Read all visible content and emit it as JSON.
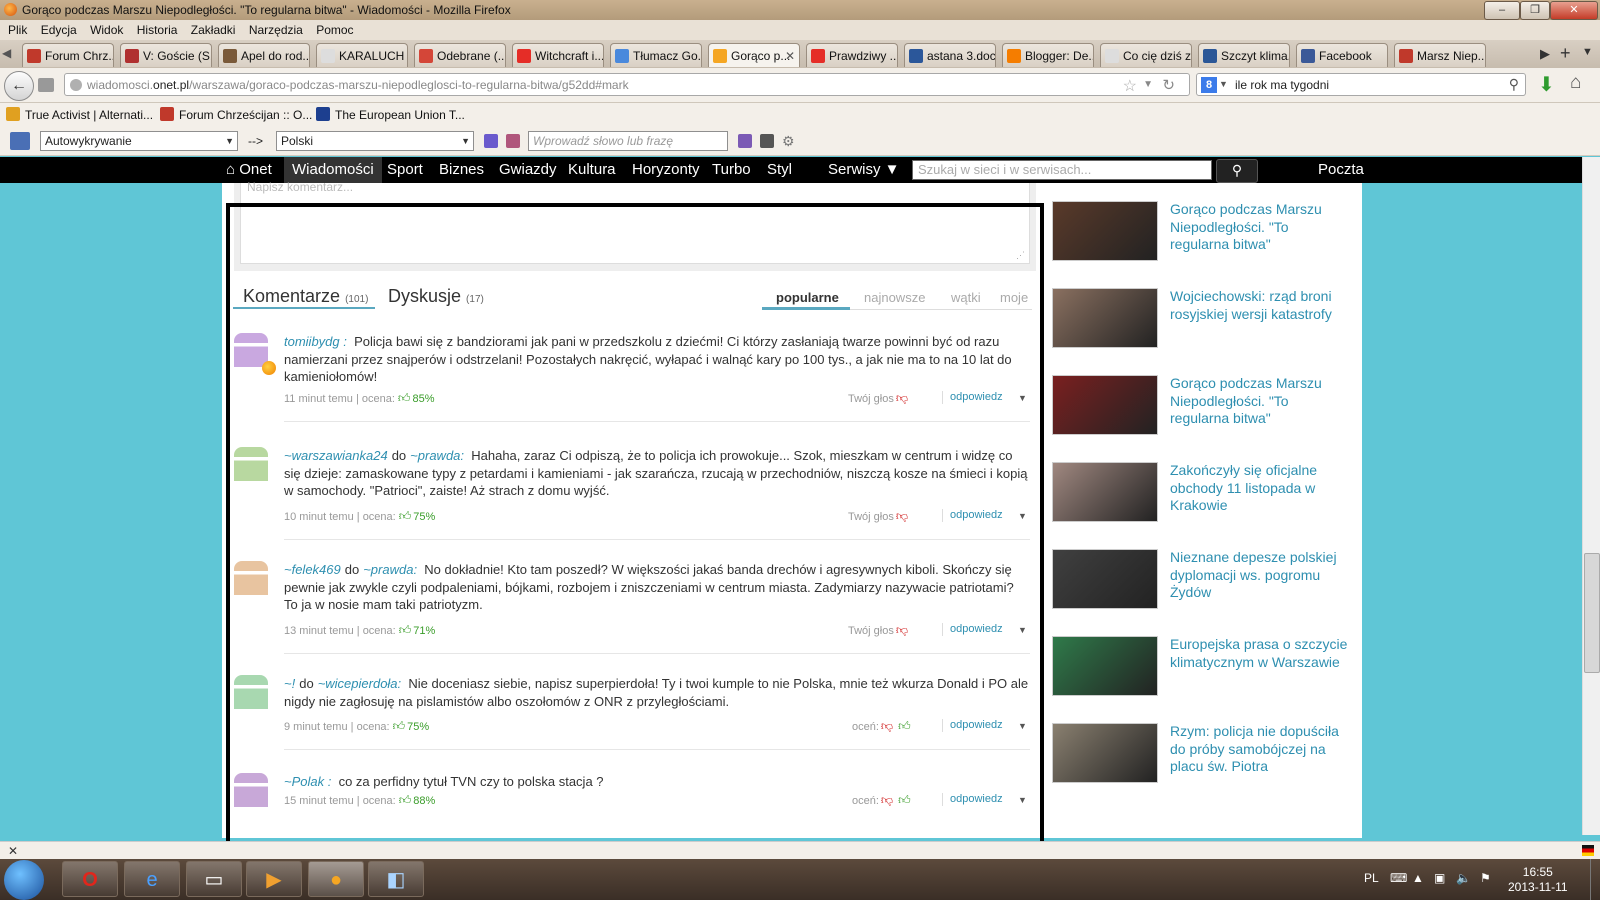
{
  "window": {
    "title": "Gorąco podczas Marszu Niepodległości. \"To regularna bitwa\" - Wiadomości - Mozilla Firefox",
    "buttons": [
      "–",
      "❐",
      "✕"
    ]
  },
  "menu": [
    "Plik",
    "Edycja",
    "Widok",
    "Historia",
    "Zakładki",
    "Narzędzia",
    "Pomoc"
  ],
  "tabs": [
    {
      "label": "Forum Chrz...",
      "icon_color": "#c0392b"
    },
    {
      "label": "V: Goście (S...",
      "icon_color": "#b03030"
    },
    {
      "label": "Apel do rod...",
      "icon_color": "#7a5a3a"
    },
    {
      "label": "KARALUCH",
      "icon_color": "#dddddd"
    },
    {
      "label": "Odebrane (...",
      "icon_color": "#d44638"
    },
    {
      "label": "Witchcraft i...",
      "icon_color": "#e52d27"
    },
    {
      "label": "Tłumacz Go...",
      "icon_color": "#4a89dc"
    },
    {
      "label": "Gorąco p...",
      "icon_color": "#f5a623",
      "active": true
    },
    {
      "label": "Prawdziwy ...",
      "icon_color": "#e52d27"
    },
    {
      "label": "astana 3.doc",
      "icon_color": "#2b579a"
    },
    {
      "label": "Blogger: De...",
      "icon_color": "#f57d00"
    },
    {
      "label": "Co cię dziś z...",
      "icon_color": "#dddddd"
    },
    {
      "label": "Szczyt klima...",
      "icon_color": "#2b5797"
    },
    {
      "label": "Facebook",
      "icon_color": "#3b5998"
    },
    {
      "label": "Marsz Niep...",
      "icon_color": "#c0392b"
    }
  ],
  "nav": {
    "url": "wiadomosci.onet.pl/warszawa/goraco-podczas-marszu-niepodleglosci-to-regularna-bitwa/g52dd#mark",
    "url_domain": "wiadomosci.",
    "url_bold": "onet.pl",
    "url_path": "/warszawa/goraco-podczas-marszu-niepodleglosci-to-regularna-bitwa/g52dd#mark",
    "search_value": "ile rok ma tygodni"
  },
  "bookmarks": [
    {
      "label": "True Activist | Alternati...",
      "icon_color": "#e0a020"
    },
    {
      "label": "Forum Chrześcijan :: O...",
      "icon_color": "#c0392b"
    },
    {
      "label": "The European Union T...",
      "icon_color": "#1d3f8f"
    }
  ],
  "translator": {
    "source_lang": "Autowykrywanie",
    "arrow": "-->",
    "target_lang": "Polski",
    "input_placeholder": "Wprowadź słowo lub frazę"
  },
  "site_nav": {
    "items": [
      "Onet",
      "Wiadomości",
      "Sport",
      "Biznes",
      "Gwiazdy",
      "Kultura",
      "Horyzonty",
      "Turbo",
      "Styl"
    ],
    "services": "Serwisy",
    "search_placeholder": "Szukaj w sieci i w serwisach...",
    "mail": "Poczta"
  },
  "comment_box": {
    "placeholder": "Napisz komentarz..."
  },
  "comments_header": {
    "tab_comments": "Komentarze",
    "comments_count": "(101)",
    "tab_discussions": "Dyskusje",
    "discussions_count": "(17)",
    "sort_options": [
      "popularne",
      "najnowsze",
      "wątki",
      "moje"
    ],
    "sort_active": "popularne"
  },
  "comments": [
    {
      "author": "tomiibydg :",
      "to": "",
      "text": "Policja bawi się z bandziorami jak pani w przedszkolu z dziećmi! Ci którzy zasłaniają twarze powinni być od razu namierzani przez snajperów i odstrzelani! Pozostałych nakręcić, wyłapać i walnąć kary po 100 tys., a jak nie ma to na 10 lat do kamieniołomów!",
      "time": "11 minut temu",
      "rating_label": "ocena:",
      "rating": "85%",
      "vote_label": "Twój głos",
      "reply": "odpowiedz",
      "avatar_color": "#c9a8e0"
    },
    {
      "author": "~warszawianka24",
      "to": "~prawda:",
      "text": "Hahaha, zaraz Ci odpiszą, że to policja ich prowokuje... Szok, mieszkam w centrum i widzę co się dzieje: zamaskowane typy z petardami i kamieniami - jak szarańcza, rzucają w przechodniów, niszczą kosze na śmieci i kopią w samochody. \"Patrioci\", zaiste! Aż strach z domu wyjść.",
      "time": "10 minut temu",
      "rating_label": "ocena:",
      "rating": "75%",
      "vote_label": "Twój głos",
      "reply": "odpowiedz",
      "avatar_color": "#b8d8a0"
    },
    {
      "author": "~felek469",
      "to": "~prawda:",
      "text": "No dokładnie! Kto tam poszedł? W większości jakaś banda drechów i agresywnych kiboli. Skończy się pewnie jak zwykle czyli podpaleniami, bójkami, rozbojem i zniszczeniami w centrum miasta. Zadymiarzy nazywacie patriotami? To ja w nosie mam taki patriotyzm.",
      "time": "13 minut temu",
      "rating_label": "ocena:",
      "rating": "71%",
      "vote_label": "Twój głos",
      "reply": "odpowiedz",
      "avatar_color": "#e8c4a0"
    },
    {
      "author": "~!",
      "to": "~wicepierdoła:",
      "text": "Nie doceniasz siebie, napisz superpierdoła! Ty i twoi kumple to nie Polska, mnie też wkurza Donald i PO ale nigdy nie zagłosuję na pislamistów albo oszołomów z ONR z przyległościami.",
      "time": "9 minut temu",
      "rating_label": "ocena:",
      "rating": "75%",
      "vote_label": "oceń:",
      "reply": "odpowiedz",
      "avatar_color": "#a8d8b0"
    },
    {
      "author": "~Polak :",
      "to": "",
      "text": "co za perfidny tytuł TVN czy to polska stacja ?",
      "time": "15 minut temu",
      "rating_label": "ocena:",
      "rating": "88%",
      "vote_label": "oceń:",
      "reply": "odpowiedz",
      "avatar_color": "#c8a8d8"
    }
  ],
  "related": [
    {
      "title": "Gorąco podczas Marszu Niepodległości. \"To regularna bitwa\"",
      "thumb_color": "#5a3a2a"
    },
    {
      "title": "Wojciechowski: rząd broni rosyjskiej wersji katastrofy",
      "thumb_color": "#8a7060"
    },
    {
      "title": "Gorąco podczas Marszu Niepodległości. \"To regularna bitwa\"",
      "thumb_color": "#7a2020"
    },
    {
      "title": "Zakończyły się oficjalne obchody 11 listopada w Krakowie",
      "thumb_color": "#a08880"
    },
    {
      "title": "Nieznane depesze polskiej dyplomacji ws. pogromu Żydów",
      "thumb_color": "#404040"
    },
    {
      "title": "Europejska prasa o szczycie klimatycznym w Warszawie",
      "thumb_color": "#2f7a4a"
    },
    {
      "title": "Rzym: policja nie dopuściła do próby samobójczej na placu św. Piotra",
      "thumb_color": "#8a8070"
    }
  ],
  "taskbar": {
    "lang": "PL",
    "time": "16:55",
    "date": "2013-11-11"
  }
}
